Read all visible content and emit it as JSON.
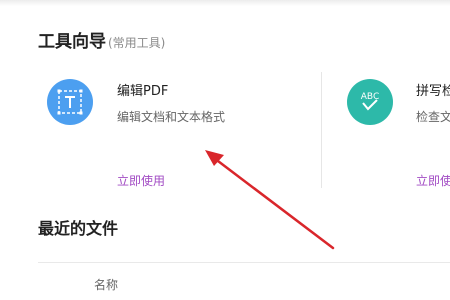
{
  "tools_section": {
    "title": "工具向导",
    "subtitle": "(常用工具)"
  },
  "tools": [
    {
      "name": "编辑PDF",
      "description": "编辑文档和文本格式",
      "action": "立即使用",
      "icon": "edit-text-icon",
      "color": "#4c9ff0"
    },
    {
      "name": "拼写检查",
      "description": "检查文档中的拼写",
      "action": "立即使用",
      "icon": "abc-check-icon",
      "color": "#2db9a9",
      "icon_text": "ABC"
    }
  ],
  "recent_section": {
    "title": "最近的文件",
    "columns": [
      "名称"
    ]
  },
  "annotation": {
    "color": "#d9262b"
  }
}
